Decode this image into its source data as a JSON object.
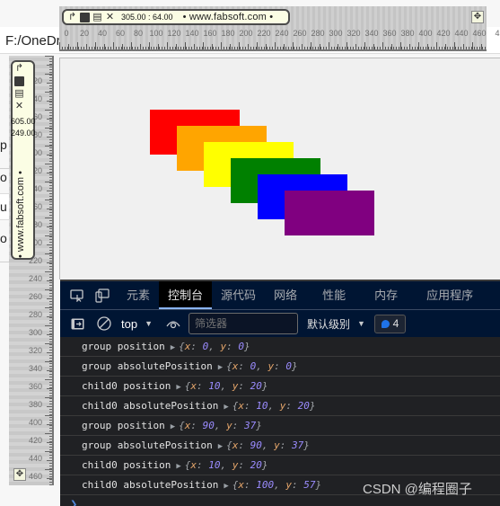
{
  "address_bar": {
    "text": "F:/OneDri"
  },
  "left_fragments": [
    "p",
    "o",
    "u",
    "o"
  ],
  "measure_toolbar": {
    "coordinates": "305.00 : 64.00",
    "brand": "• www.fabsoft.com •",
    "vertical_coords": [
      "605.00",
      "249.00"
    ],
    "icons": [
      "rotate-icon",
      "save-icon",
      "ruler-icon",
      "close-icon"
    ]
  },
  "horizontal_ruler": {
    "labels": [
      "0",
      "20",
      "40",
      "60",
      "80",
      "100",
      "120",
      "140",
      "160",
      "180",
      "200",
      "220",
      "240",
      "260",
      "280",
      "300",
      "320",
      "340",
      "360",
      "380",
      "400",
      "420",
      "440",
      "460",
      "4"
    ]
  },
  "vertical_ruler": {
    "labels": [
      "20",
      "40",
      "60",
      "80",
      "100",
      "120",
      "140",
      "160",
      "180",
      "200",
      "220",
      "240",
      "260",
      "280",
      "300",
      "320",
      "340",
      "360",
      "380",
      "400",
      "420",
      "440",
      "460"
    ]
  },
  "canvas": {
    "rectangles": [
      {
        "name": "red",
        "color": "#ff0000"
      },
      {
        "name": "orange",
        "color": "#ffa500"
      },
      {
        "name": "yellow",
        "color": "#ffff00"
      },
      {
        "name": "green",
        "color": "#008000"
      },
      {
        "name": "blue",
        "color": "#0000ff"
      },
      {
        "name": "purple",
        "color": "#800080"
      }
    ]
  },
  "devtools": {
    "tabs": [
      {
        "label": "元素",
        "active": false
      },
      {
        "label": "控制台",
        "active": true
      },
      {
        "label": "源代码",
        "active": false
      },
      {
        "label": "网络",
        "active": false
      },
      {
        "label": "性能",
        "active": false
      },
      {
        "label": "内存",
        "active": false
      },
      {
        "label": "应用程序",
        "active": false
      }
    ],
    "context": "top",
    "filter_placeholder": "筛选器",
    "level": "默认级别",
    "message_count": "4",
    "logs": [
      {
        "label": "group position",
        "x": "0",
        "y": "0"
      },
      {
        "label": "group absolutePosition",
        "x": "0",
        "y": "0"
      },
      {
        "label": "child0 position",
        "x": "10",
        "y": "20"
      },
      {
        "label": "child0 absolutePosition",
        "x": "10",
        "y": "20"
      },
      {
        "label": "group position",
        "x": "90",
        "y": "37"
      },
      {
        "label": "group absolutePosition",
        "x": "90",
        "y": "37"
      },
      {
        "label": "child0 position",
        "x": "10",
        "y": "20"
      },
      {
        "label": "child0 absolutePosition",
        "x": "100",
        "y": "57"
      }
    ]
  },
  "watermark": "CSDN @编程圈子"
}
